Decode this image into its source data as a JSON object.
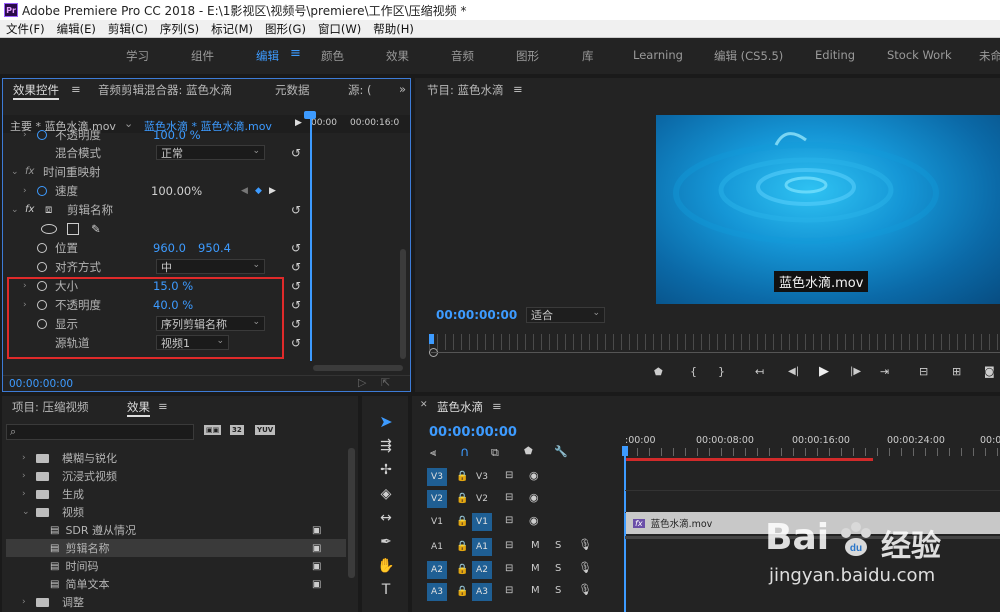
{
  "titlebar": {
    "logo": "Pr",
    "title": "Adobe Premiere Pro CC 2018 - E:\\1影视区\\视频号\\premiere\\工作区\\压缩视频 *"
  },
  "menus": [
    "文件(F)",
    "编辑(E)",
    "剪辑(C)",
    "序列(S)",
    "标记(M)",
    "图形(G)",
    "窗口(W)",
    "帮助(H)"
  ],
  "workspaces": {
    "items": [
      "学习",
      "组件",
      "编辑",
      "颜色",
      "效果",
      "音频",
      "图形",
      "库",
      "Learning",
      "编辑 (CS5.5)",
      "Editing",
      "Stock Work",
      "未命"
    ],
    "active": "编辑",
    "menu_icon": "hamburger-icon"
  },
  "effect_controls": {
    "tabs": [
      "效果控件",
      "音频剪辑混合器: 蓝色水滴",
      "元数据",
      "源: ("
    ],
    "master_label": "主要 * 蓝色水滴.mov",
    "clip_label": "蓝色水滴 * 蓝色水滴.mov",
    "ruler": [
      "00:00",
      "00:00:16:0"
    ],
    "rows": {
      "opacity_partial": {
        "label": "不透明度",
        "value": "100.0 %"
      },
      "blend": {
        "label": "混合模式",
        "value": "正常"
      },
      "time_remap": {
        "label": "时间重映射"
      },
      "speed": {
        "label": "速度",
        "value": "100.00%"
      },
      "clip_name": {
        "label": "剪辑名称"
      },
      "position": {
        "label": "位置",
        "x": "960.0",
        "y": "950.4"
      },
      "align": {
        "label": "对齐方式",
        "value": "中"
      },
      "size": {
        "label": "大小",
        "value": "15.0 %"
      },
      "opacity": {
        "label": "不透明度",
        "value": "40.0 %"
      },
      "display": {
        "label": "显示",
        "value": "序列剪辑名称"
      },
      "source_track": {
        "label": "源轨道",
        "value": "视频1"
      }
    },
    "timecode": "00:00:00:00"
  },
  "program": {
    "title": "节目: 蓝色水滴",
    "overlay": "蓝色水滴.mov",
    "timecode": "00:00:00:00",
    "fit": "适合"
  },
  "project": {
    "tabs": [
      "项目: 压缩视频",
      "效果"
    ],
    "search_placeholder": "",
    "items": [
      {
        "label": "模糊与锐化",
        "type": "folder"
      },
      {
        "label": "沉浸式视频",
        "type": "folder"
      },
      {
        "label": "生成",
        "type": "folder"
      },
      {
        "label": "视频",
        "type": "folder",
        "open": true
      },
      {
        "label": "SDR 遵从情况",
        "type": "effect"
      },
      {
        "label": "剪辑名称",
        "type": "effect",
        "selected": true
      },
      {
        "label": "时间码",
        "type": "effect"
      },
      {
        "label": "简单文本",
        "type": "effect"
      },
      {
        "label": "调整",
        "type": "folder"
      }
    ],
    "badges": [
      "32",
      "YUV"
    ]
  },
  "timeline": {
    "title": "蓝色水滴",
    "timecode": "00:00:00:00",
    "ruler": [
      ":00:00",
      "00:00:08:00",
      "00:00:16:00",
      "00:00:24:00",
      "00:0"
    ],
    "tracks": [
      {
        "id": "V3",
        "src": "V3"
      },
      {
        "id": "V2",
        "src": "V2"
      },
      {
        "id": "V1",
        "src": "V1"
      },
      {
        "id": "A1",
        "src": "A1"
      },
      {
        "id": "A2",
        "src": "A2"
      },
      {
        "id": "A3",
        "src": "A3"
      }
    ],
    "clip": {
      "label": "蓝色水滴.mov",
      "fx": "fx"
    },
    "mute": "M",
    "solo": "S"
  },
  "watermark": {
    "brand": "Bai",
    "brand2": "经验",
    "url": "jingyan.baidu.com"
  }
}
